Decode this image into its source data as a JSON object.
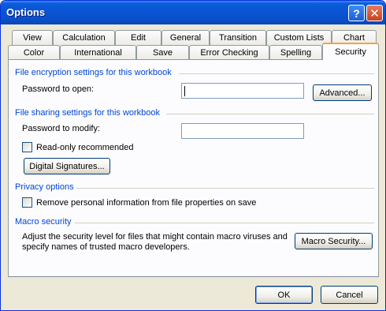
{
  "window": {
    "title": "Options"
  },
  "tabs": {
    "row1": [
      "View",
      "Calculation",
      "Edit",
      "General",
      "Transition",
      "Custom Lists",
      "Chart"
    ],
    "row2": [
      "Color",
      "International",
      "Save",
      "Error Checking",
      "Spelling",
      "Security"
    ],
    "active": "Security"
  },
  "encryption": {
    "section_title": "File encryption settings for this workbook",
    "password_open_label": "Password to open:",
    "password_open_value": "",
    "advanced_button": "Advanced..."
  },
  "sharing": {
    "section_title": "File sharing settings for this workbook",
    "password_modify_label": "Password to modify:",
    "password_modify_value": "",
    "readonly_label": "Read-only recommended",
    "readonly_checked": false,
    "digital_signatures_button": "Digital Signatures..."
  },
  "privacy": {
    "section_title": "Privacy options",
    "remove_info_label": "Remove personal information from file properties on save",
    "remove_info_checked": false
  },
  "macro": {
    "section_title": "Macro security",
    "description_line1": "Adjust the security level for files that might contain macro viruses and",
    "description_line2": "specify names of trusted macro developers.",
    "macro_security_button": "Macro Security..."
  },
  "footer": {
    "ok_button": "OK",
    "cancel_button": "Cancel"
  }
}
